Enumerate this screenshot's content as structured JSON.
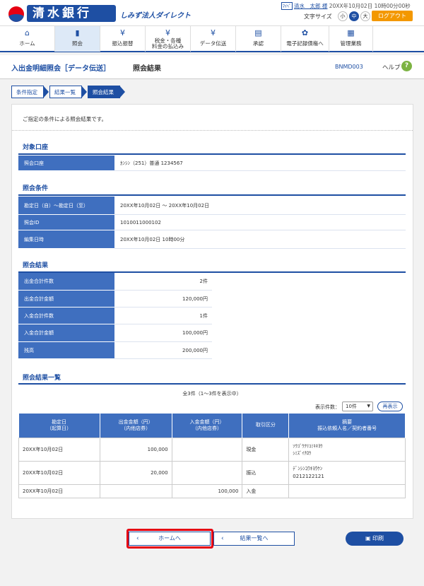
{
  "brand": {
    "name": "清水銀行",
    "service": "しみず法人ダイレクト"
  },
  "user": {
    "icon": "info-icon",
    "icon_label": "ﾏｲﾍﾟ",
    "name": "清水　太郎 様",
    "login_time": "20XX年10月02日 10時00分00秒"
  },
  "font_size": {
    "label": "文字サイズ",
    "options": [
      "小",
      "中",
      "大"
    ],
    "selected": "中"
  },
  "logout": "ログアウト",
  "nav": [
    {
      "label": "ホーム",
      "icon": "home-icon",
      "glyph": "⌂"
    },
    {
      "label": "照会",
      "icon": "document-icon",
      "glyph": "▮",
      "active": true
    },
    {
      "label": "振込振替",
      "icon": "transfer-icon",
      "glyph": "¥"
    },
    {
      "label": "税金・各種\n料金の払込み",
      "icon": "tax-icon",
      "glyph": "¥"
    },
    {
      "label": "データ伝送",
      "icon": "data-icon",
      "glyph": "¥"
    },
    {
      "label": "承認",
      "icon": "approval-icon",
      "glyph": "▤"
    },
    {
      "label": "電子記録債権へ",
      "icon": "link-icon",
      "glyph": "✿"
    },
    {
      "label": "管理業務",
      "icon": "admin-icon",
      "glyph": "▦"
    }
  ],
  "page": {
    "title": "入出金明細照会［データ伝送］",
    "subtitle": "照会結果",
    "screen_code": "BNMD003",
    "help": "ヘルプ",
    "help_icon": "?"
  },
  "steps": [
    "条件指定",
    "結果一覧",
    "照会結果"
  ],
  "intro": "ご指定の条件による照会結果です。",
  "account": {
    "heading": "対象口座",
    "label": "照会口座",
    "value": "ｶﾝｼﾝ（251）普通 1234567"
  },
  "conditions": {
    "heading": "照会条件",
    "rows": [
      {
        "label": "勘定日（自）～勘定日（至）",
        "value": "20XX年10月02日 ～ 20XX年10月02日"
      },
      {
        "label": "照会ID",
        "value": "1010011000102"
      },
      {
        "label": "編集日時",
        "value": "20XX年10月02日 10時00分"
      }
    ]
  },
  "summary": {
    "heading": "照会結果",
    "rows": [
      {
        "label": "出金合計件数",
        "value": "2件"
      },
      {
        "label": "出金合計金額",
        "value": "120,000円"
      },
      {
        "label": "入金合計件数",
        "value": "1件"
      },
      {
        "label": "入金合計金額",
        "value": "100,000円"
      },
      {
        "label": "残高",
        "value": "200,000円"
      }
    ]
  },
  "list": {
    "heading": "照会結果一覧",
    "count": "全3件（1～3件を表示中）",
    "rows_label": "表示件数：",
    "rows_value": "10件",
    "redisplay": "再表示",
    "headers": [
      "勘定日\n（起算日）",
      "出金金額（円）\n（内他店券）",
      "入金金額（円）\n（内他店券）",
      "取引区分",
      "摘要\n振込依頼人名／契約者番号"
    ],
    "rows": [
      {
        "date": "20XX年10月02日",
        "out": "100,000",
        "in": "",
        "type": "現金",
        "memo": "ｿｳｺﾞｳｸﾘｺﾐｷｷﾖｳ\nｼﾐｽﾞｲﾁﾛｳ"
      },
      {
        "date": "20XX年10月02日",
        "out": "20,000",
        "in": "",
        "type": "振込",
        "memo": "ﾃﾞﾝｼﾝｺｳｷﾖｳｹﾝ\n0212122121"
      },
      {
        "date": "20XX年10月02日",
        "out": "",
        "in": "100,000",
        "type": "入金",
        "memo": ""
      }
    ]
  },
  "buttons": {
    "home": "ホームへ",
    "back": "結果一覧へ",
    "print": "印刷"
  }
}
